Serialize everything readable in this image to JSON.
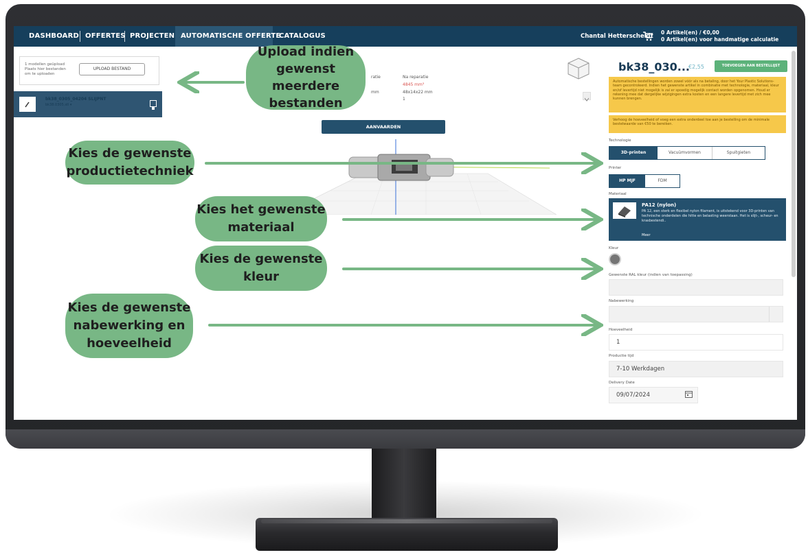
{
  "nav": {
    "items": [
      "DASHBOARD",
      "OFFERTES",
      "PROJECTEN",
      "AUTOMATISCHE OFFERTE",
      "CATALOGUS"
    ],
    "user": "Chantal Hetterscheidt",
    "cart_line1": "0 Artikel(en) / €0,00",
    "cart_line2": "0 Artikel(en) voor handmatige calculatie"
  },
  "upload": {
    "info1": "1 modellen geüpload",
    "info2": "Plaats hier bestanden",
    "info3": "om te uploaden",
    "button": "UPLOAD BESTAND"
  },
  "model": {
    "name": "bk38_0305_04204 SLIJPNT",
    "sub": "bk38.0305.stl ▾"
  },
  "dimensions": {
    "header_left": "ratie",
    "header_right": "Na reparatie",
    "volume": "4845 mm³",
    "size_left": "mm",
    "size_right": "48x14x22 mm",
    "count": "1"
  },
  "accept_button": "AANVAARDEN",
  "product": {
    "title": "bk38_030...",
    "price": "€2,55",
    "add_button": "TOEVOEGEN AAN BESTELLIJST",
    "notice1": "Automatische bestellingen worden zowel vóór als na betaling, door het Your Plastic Solutions-team gecontroleerd. Indien het gewenste artikel in combinatie met technologie, materiaal, kleur en/of levertijd niet mogelijk is zal er spoedig mogelijk contact worden opgenomen. Houd er rekening mee dat dergelijke wijzigingen extra kosten en een langere levertijd met zich mee kunnen brengen.",
    "notice2": "Verhoog de hoeveelheid of voeg een extra onderdeel toe aan je bestelling om de minimale bestelwaarde van €50 te bereiken."
  },
  "technologie": {
    "label": "Technologie",
    "options": [
      "3D-printen",
      "Vacuümvormen",
      "Spuitgieten"
    ],
    "selected": "3D-printen"
  },
  "printer": {
    "label": "Printer",
    "options": [
      "HP MJF",
      "FDM"
    ],
    "selected": "HP MJF"
  },
  "materiaal": {
    "label": "Materiaal",
    "name": "PA12 (nylon)",
    "description": "PA 12, een sterk en flexibel nylon filament, is uitstekend voor 3D-printen van technische onderdelen die hitte en belasting weerstaan. Het is slijt-, scheur- en krasbestendi..",
    "more": "Meer"
  },
  "kleur": {
    "label": "Kleur",
    "swatch": "#757575"
  },
  "ral": {
    "label": "Gewenste RAL kleur (indien van toepassing)",
    "value": ""
  },
  "nabewerking": {
    "label": "Nabewerking",
    "value": ""
  },
  "hoeveelheid": {
    "label": "Hoeveelheid",
    "value": "1"
  },
  "productietijd": {
    "label": "Productie tijd",
    "value": "7-10 Werkdagen"
  },
  "delivery": {
    "label": "Delivery Date",
    "value": "09/07/2024"
  },
  "annotations": {
    "upload_l1": "Upload indien",
    "upload_l2": "gewenst meerdere",
    "upload_l3": "bestanden",
    "techniek_l1": "Kies de gewenste",
    "techniek_l2": "productietechniek",
    "materiaal_l1": "Kies het gewenste",
    "materiaal_l2": "materiaal",
    "kleur_l1": "Kies de gewenste",
    "kleur_l2": "kleur",
    "nabewerking_l1": "Kies de gewenste",
    "nabewerking_l2": "nabewerking en",
    "nabewerking_l3": "hoeveelheid"
  },
  "colors": {
    "nav": "#163f5c",
    "accent_blue": "#24506d",
    "green_bubble": "#78b785",
    "green_button": "#5cb27a",
    "notice_yellow": "#f6c84a"
  }
}
